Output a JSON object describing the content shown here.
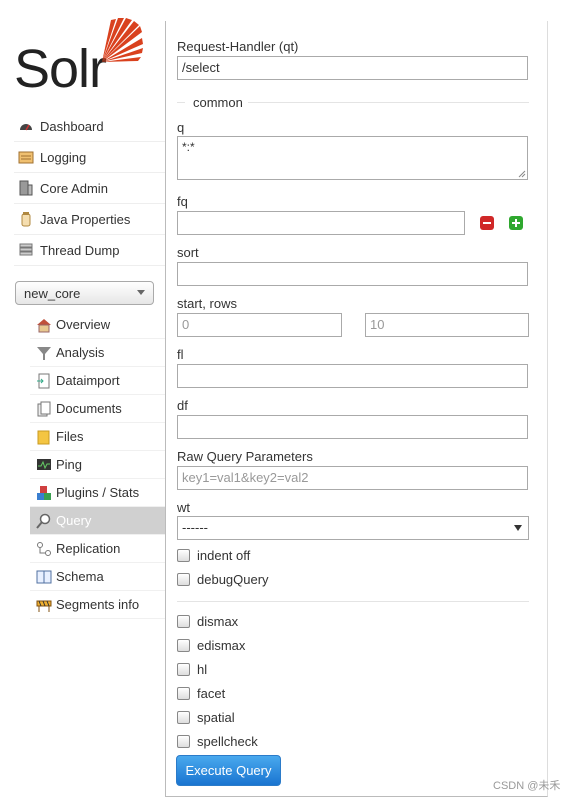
{
  "logo": {
    "text": "Solr"
  },
  "main_nav": [
    {
      "label": "Dashboard",
      "icon": "dashboard-icon"
    },
    {
      "label": "Logging",
      "icon": "logging-icon"
    },
    {
      "label": "Core Admin",
      "icon": "core-admin-icon"
    },
    {
      "label": "Java Properties",
      "icon": "java-properties-icon"
    },
    {
      "label": "Thread Dump",
      "icon": "thread-dump-icon"
    }
  ],
  "core_selector": {
    "value": "new_core"
  },
  "core_nav": [
    {
      "label": "Overview",
      "icon": "home-icon"
    },
    {
      "label": "Analysis",
      "icon": "funnel-icon"
    },
    {
      "label": "Dataimport",
      "icon": "dataimport-icon"
    },
    {
      "label": "Documents",
      "icon": "documents-icon"
    },
    {
      "label": "Files",
      "icon": "folder-icon"
    },
    {
      "label": "Ping",
      "icon": "ping-icon"
    },
    {
      "label": "Plugins / Stats",
      "icon": "plugins-icon"
    },
    {
      "label": "Query",
      "icon": "magnifier-icon",
      "active": true
    },
    {
      "label": "Replication",
      "icon": "replication-icon"
    },
    {
      "label": "Schema",
      "icon": "schema-icon"
    },
    {
      "label": "Segments info",
      "icon": "segments-icon"
    }
  ],
  "form": {
    "request_handler": {
      "label": "Request-Handler (qt)",
      "value": "/select"
    },
    "section_common": "common",
    "q": {
      "label": "q",
      "value": "*:*"
    },
    "fq": {
      "label": "fq",
      "value": ""
    },
    "sort": {
      "label": "sort",
      "value": ""
    },
    "start_rows": {
      "label": "start, rows",
      "start_placeholder": "0",
      "rows_placeholder": "10"
    },
    "fl": {
      "label": "fl",
      "value": ""
    },
    "df": {
      "label": "df",
      "value": ""
    },
    "raw": {
      "label": "Raw Query Parameters",
      "placeholder": "key1=val1&key2=val2"
    },
    "wt": {
      "label": "wt",
      "value": "------"
    },
    "checkboxes_a": [
      "indent off",
      "debugQuery"
    ],
    "checkboxes_b": [
      "dismax",
      "edismax",
      "hl",
      "facet",
      "spatial",
      "spellcheck"
    ],
    "execute_label": "Execute Query"
  },
  "watermark": "CSDN @未禾",
  "colors": {
    "accent_red": "#d9411e",
    "button_blue": "#1a74d0",
    "active_bg": "#d0d0d0"
  }
}
